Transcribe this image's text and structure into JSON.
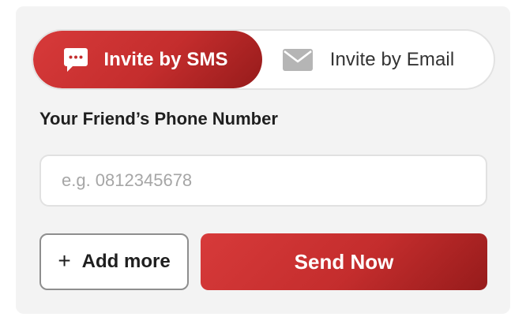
{
  "tabs": {
    "sms": {
      "label": "Invite by SMS",
      "icon": "sms-chat-icon",
      "active": true
    },
    "email": {
      "label": "Invite by Email",
      "icon": "envelope-icon",
      "active": false
    }
  },
  "form": {
    "phone_label": "Your Friend’s Phone Number",
    "phone_placeholder": "e.g. 0812345678",
    "phone_value": ""
  },
  "actions": {
    "add_more_icon": "plus-icon",
    "add_more_label": "Add more",
    "send_label": "Send Now"
  },
  "colors": {
    "accent": "#c42d2d",
    "accent_dark": "#961b1b",
    "card_background": "#f3f3f3",
    "border": "#e1e1e1",
    "placeholder_text": "#a6a6a6"
  }
}
